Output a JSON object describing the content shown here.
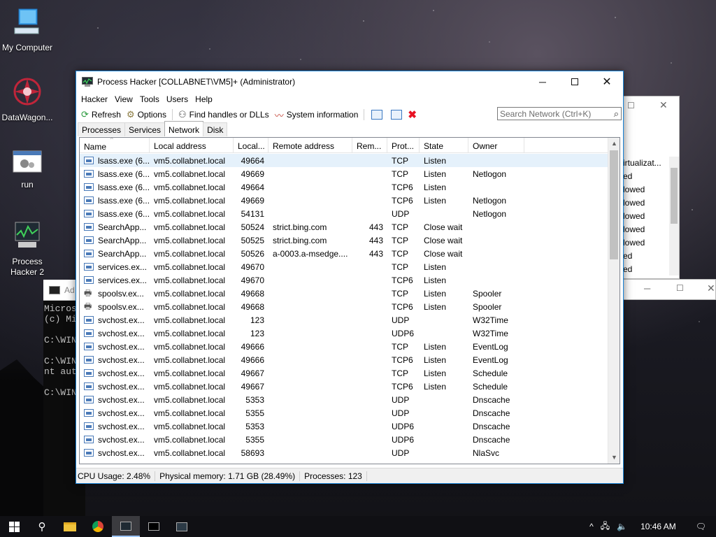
{
  "desktop": {
    "icons": [
      {
        "label": "My Computer"
      },
      {
        "label": "DataWagon..."
      },
      {
        "label": "run"
      },
      {
        "label": "Process\nHacker 2"
      }
    ]
  },
  "bg_window": {
    "items": [
      "irtualizat...",
      "ed",
      "lowed",
      "lowed",
      "lowed",
      "lowed",
      "lowed",
      "ed",
      "ed"
    ]
  },
  "console": {
    "title": "Ad",
    "lines": "Micros\n(c) Mi\n\nC:\\WIN\n\nC:\\WIN\nnt aut\n\nC:\\WIN"
  },
  "window": {
    "title": "Process Hacker [COLLABNET\\VM5]+ (Administrator)",
    "menu": [
      "Hacker",
      "View",
      "Tools",
      "Users",
      "Help"
    ],
    "toolbar": {
      "refresh": "Refresh",
      "options": "Options",
      "find_handles": "Find handles or DLLs",
      "system_info": "System information"
    },
    "search_placeholder": "Search Network (Ctrl+K)",
    "tabs": [
      "Processes",
      "Services",
      "Network",
      "Disk"
    ],
    "active_tab": "Network",
    "columns": [
      "Name",
      "Local address",
      "Local...",
      "Remote address",
      "Rem...",
      "Prot...",
      "State",
      "Owner"
    ],
    "rows": [
      {
        "name": "lsass.exe (6...",
        "laddr": "vm5.collabnet.local",
        "lport": "49664",
        "raddr": "",
        "rport": "",
        "proto": "TCP",
        "state": "Listen",
        "owner": "",
        "icon": "app"
      },
      {
        "name": "lsass.exe (6...",
        "laddr": "vm5.collabnet.local",
        "lport": "49669",
        "raddr": "",
        "rport": "",
        "proto": "TCP",
        "state": "Listen",
        "owner": "Netlogon",
        "icon": "app"
      },
      {
        "name": "lsass.exe (6...",
        "laddr": "vm5.collabnet.local",
        "lport": "49664",
        "raddr": "",
        "rport": "",
        "proto": "TCP6",
        "state": "Listen",
        "owner": "",
        "icon": "app"
      },
      {
        "name": "lsass.exe (6...",
        "laddr": "vm5.collabnet.local",
        "lport": "49669",
        "raddr": "",
        "rport": "",
        "proto": "TCP6",
        "state": "Listen",
        "owner": "Netlogon",
        "icon": "app"
      },
      {
        "name": "lsass.exe (6...",
        "laddr": "vm5.collabnet.local",
        "lport": "54131",
        "raddr": "",
        "rport": "",
        "proto": "UDP",
        "state": "",
        "owner": "Netlogon",
        "icon": "app"
      },
      {
        "name": "SearchApp...",
        "laddr": "vm5.collabnet.local",
        "lport": "50524",
        "raddr": "strict.bing.com",
        "rport": "443",
        "proto": "TCP",
        "state": "Close wait",
        "owner": "",
        "icon": "app"
      },
      {
        "name": "SearchApp...",
        "laddr": "vm5.collabnet.local",
        "lport": "50525",
        "raddr": "strict.bing.com",
        "rport": "443",
        "proto": "TCP",
        "state": "Close wait",
        "owner": "",
        "icon": "app"
      },
      {
        "name": "SearchApp...",
        "laddr": "vm5.collabnet.local",
        "lport": "50526",
        "raddr": "a-0003.a-msedge....",
        "rport": "443",
        "proto": "TCP",
        "state": "Close wait",
        "owner": "",
        "icon": "app"
      },
      {
        "name": "services.ex...",
        "laddr": "vm5.collabnet.local",
        "lport": "49670",
        "raddr": "",
        "rport": "",
        "proto": "TCP",
        "state": "Listen",
        "owner": "",
        "icon": "app"
      },
      {
        "name": "services.ex...",
        "laddr": "vm5.collabnet.local",
        "lport": "49670",
        "raddr": "",
        "rport": "",
        "proto": "TCP6",
        "state": "Listen",
        "owner": "",
        "icon": "app"
      },
      {
        "name": "spoolsv.ex...",
        "laddr": "vm5.collabnet.local",
        "lport": "49668",
        "raddr": "",
        "rport": "",
        "proto": "TCP",
        "state": "Listen",
        "owner": "Spooler",
        "icon": "printer"
      },
      {
        "name": "spoolsv.ex...",
        "laddr": "vm5.collabnet.local",
        "lport": "49668",
        "raddr": "",
        "rport": "",
        "proto": "TCP6",
        "state": "Listen",
        "owner": "Spooler",
        "icon": "printer"
      },
      {
        "name": "svchost.ex...",
        "laddr": "vm5.collabnet.local",
        "lport": "123",
        "raddr": "",
        "rport": "",
        "proto": "UDP",
        "state": "",
        "owner": "W32Time",
        "icon": "app"
      },
      {
        "name": "svchost.ex...",
        "laddr": "vm5.collabnet.local",
        "lport": "123",
        "raddr": "",
        "rport": "",
        "proto": "UDP6",
        "state": "",
        "owner": "W32Time",
        "icon": "app"
      },
      {
        "name": "svchost.ex...",
        "laddr": "vm5.collabnet.local",
        "lport": "49666",
        "raddr": "",
        "rport": "",
        "proto": "TCP",
        "state": "Listen",
        "owner": "EventLog",
        "icon": "app"
      },
      {
        "name": "svchost.ex...",
        "laddr": "vm5.collabnet.local",
        "lport": "49666",
        "raddr": "",
        "rport": "",
        "proto": "TCP6",
        "state": "Listen",
        "owner": "EventLog",
        "icon": "app"
      },
      {
        "name": "svchost.ex...",
        "laddr": "vm5.collabnet.local",
        "lport": "49667",
        "raddr": "",
        "rport": "",
        "proto": "TCP",
        "state": "Listen",
        "owner": "Schedule",
        "icon": "app"
      },
      {
        "name": "svchost.ex...",
        "laddr": "vm5.collabnet.local",
        "lport": "49667",
        "raddr": "",
        "rport": "",
        "proto": "TCP6",
        "state": "Listen",
        "owner": "Schedule",
        "icon": "app"
      },
      {
        "name": "svchost.ex...",
        "laddr": "vm5.collabnet.local",
        "lport": "5353",
        "raddr": "",
        "rport": "",
        "proto": "UDP",
        "state": "",
        "owner": "Dnscache",
        "icon": "app"
      },
      {
        "name": "svchost.ex...",
        "laddr": "vm5.collabnet.local",
        "lport": "5355",
        "raddr": "",
        "rport": "",
        "proto": "UDP",
        "state": "",
        "owner": "Dnscache",
        "icon": "app"
      },
      {
        "name": "svchost.ex...",
        "laddr": "vm5.collabnet.local",
        "lport": "5353",
        "raddr": "",
        "rport": "",
        "proto": "UDP6",
        "state": "",
        "owner": "Dnscache",
        "icon": "app"
      },
      {
        "name": "svchost.ex...",
        "laddr": "vm5.collabnet.local",
        "lport": "5355",
        "raddr": "",
        "rport": "",
        "proto": "UDP6",
        "state": "",
        "owner": "Dnscache",
        "icon": "app"
      },
      {
        "name": "svchost.ex...",
        "laddr": "vm5.collabnet.local",
        "lport": "58693",
        "raddr": "",
        "rport": "",
        "proto": "UDP",
        "state": "",
        "owner": "NlaSvc",
        "icon": "app"
      }
    ],
    "status": {
      "cpu": "CPU Usage: 2.48%",
      "memory": "Physical memory: 1.71 GB (28.49%)",
      "processes": "Processes: 123"
    }
  },
  "taskbar": {
    "time": "10:46 AM"
  },
  "colors": {
    "accent": "#1883d7",
    "selected_row": "#e5f1fb",
    "close_red": "#e81123"
  }
}
